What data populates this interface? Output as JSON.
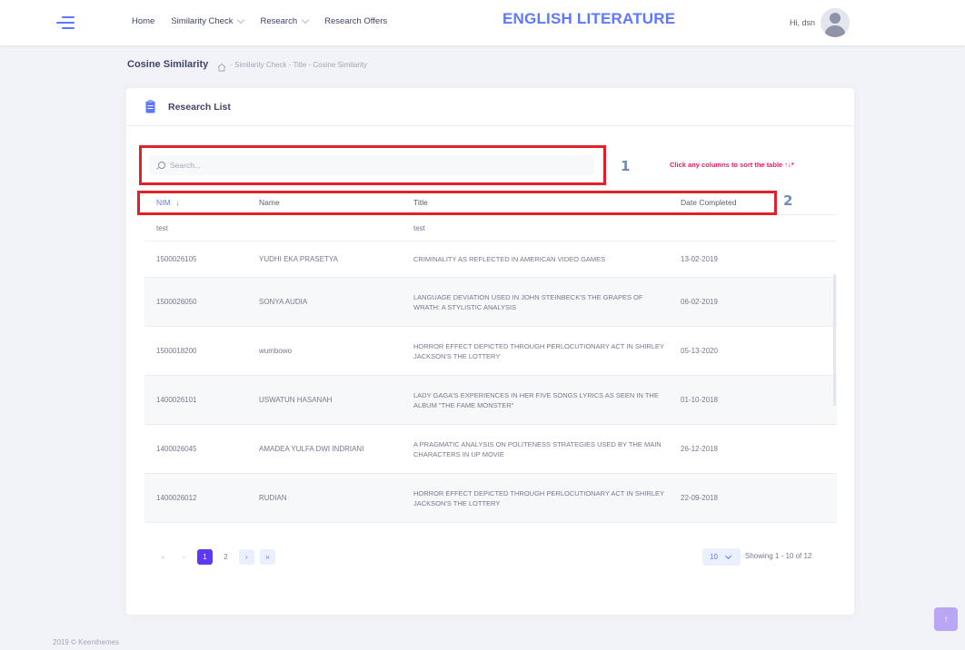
{
  "header": {
    "nav": [
      {
        "label": "Home",
        "dropdown": false
      },
      {
        "label": "Similarity Check",
        "dropdown": true
      },
      {
        "label": "Research",
        "dropdown": true
      },
      {
        "label": "Research Offers",
        "dropdown": false
      }
    ],
    "brand": "ENGLISH LITERATURE",
    "greeting": "Hi, dsn"
  },
  "subheader": {
    "title": "Cosine Similarity",
    "breadcrumbs": "- Similarity Check - Title - Cosine Similarity"
  },
  "card": {
    "title": "Research List",
    "search_placeholder": "Search...",
    "hint": "Click any columns to sort the table ↑↓*",
    "annotation_1": "1",
    "annotation_2": "2",
    "columns": {
      "nim": "NIM",
      "name": "Name",
      "title": "Title",
      "date": "Date Completed"
    },
    "sort_indicator": "↓",
    "rows": [
      {
        "nim": "test",
        "name": "",
        "title": "test",
        "date": ""
      },
      {
        "nim": "1500026105",
        "name": "YUDHI EKA PRASETYA",
        "title": "CRIMINALITY AS REFLECTED IN AMERICAN VIDEO GAMES",
        "date": "13-02-2019"
      },
      {
        "nim": "1500026050",
        "name": "SONYA AUDIA",
        "title": "LANGUAGE DEVIATION USED IN JOHN STEINBECK'S THE GRAPES OF WRATH: A STYLISTIC ANALYSIS",
        "date": "06-02-2019"
      },
      {
        "nim": "1500018200",
        "name": "wumbowo",
        "title": "HORROR EFFECT DEPICTED THROUGH PERLOCUTIONARY ACT IN SHIRLEY JACKSON'S THE LOTTERY",
        "date": "05-13-2020"
      },
      {
        "nim": "1400026101",
        "name": "USWATUN HASANAH",
        "title": "LADY GAGA'S EXPERIENCES IN HER FIVE SONGS LYRICS AS SEEN IN THE ALBUM \"THE FAME MONSTER\"",
        "date": "01-10-2018"
      },
      {
        "nim": "1400026045",
        "name": "AMADEA YULFA DWI INDRIANI",
        "title": "A PRAGMATIC ANALYSIS ON POLITENESS STRATEGIES USED BY THE MAIN CHARACTERS IN UP MOVIE",
        "date": "26-12-2018"
      },
      {
        "nim": "1400026012",
        "name": "RUDIAN",
        "title": "HORROR EFFECT DEPICTED THROUGH PERLOCUTIONARY ACT IN SHIRLEY JACKSON'S THE LOTTERY",
        "date": "22-09-2018"
      }
    ],
    "pagination": {
      "first": "«",
      "prev": "‹",
      "pages": [
        "1",
        "2"
      ],
      "current": "1",
      "next": "›",
      "last": "»",
      "per_page": "10",
      "showing": "Showing 1 - 10 of 12"
    }
  },
  "footer": "2019 © Keenthemes",
  "scroll_top": "↑",
  "colors": {
    "brand": "#5d78ff",
    "active_page": "#5d38f5",
    "hint": "#fd1361",
    "annotation_box": "#e0202a"
  }
}
